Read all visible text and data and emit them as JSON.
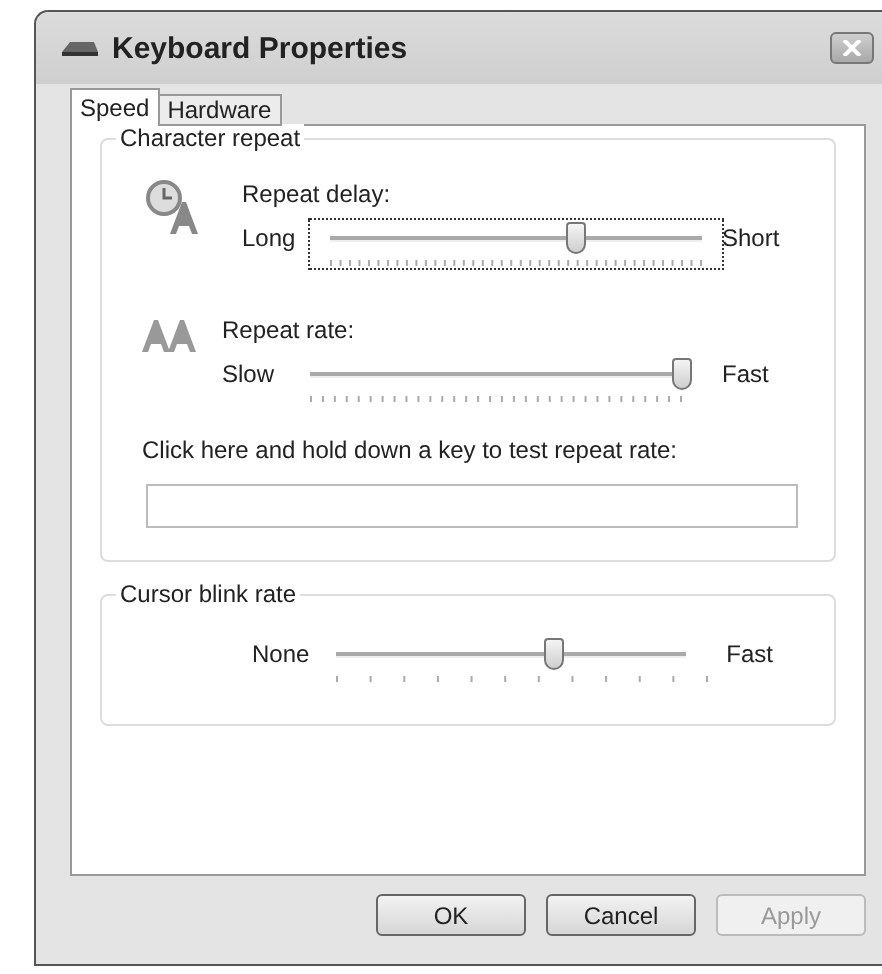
{
  "window": {
    "title": "Keyboard Properties"
  },
  "tabs": [
    {
      "label": "Speed",
      "selected": true
    },
    {
      "label": "Hardware",
      "selected": false
    }
  ],
  "character_repeat": {
    "title": "Character repeat",
    "delay": {
      "label": "Repeat delay:",
      "min_label": "Long",
      "max_label": "Short",
      "level": 0.66,
      "focused": true
    },
    "rate": {
      "label": "Repeat rate:",
      "min_label": "Slow",
      "max_label": "Fast",
      "level": 1.0,
      "focused": false
    },
    "test": {
      "label": "Click here and hold down a key to test repeat rate:"
    }
  },
  "cursor_blink": {
    "title": "Cursor blink rate",
    "min_label": "None",
    "max_label": "Fast",
    "level": 0.62,
    "focused": false
  },
  "buttons": [
    {
      "label": "OK",
      "disabled": false
    },
    {
      "label": "Cancel",
      "disabled": false
    },
    {
      "label": "Apply",
      "disabled": true
    }
  ]
}
